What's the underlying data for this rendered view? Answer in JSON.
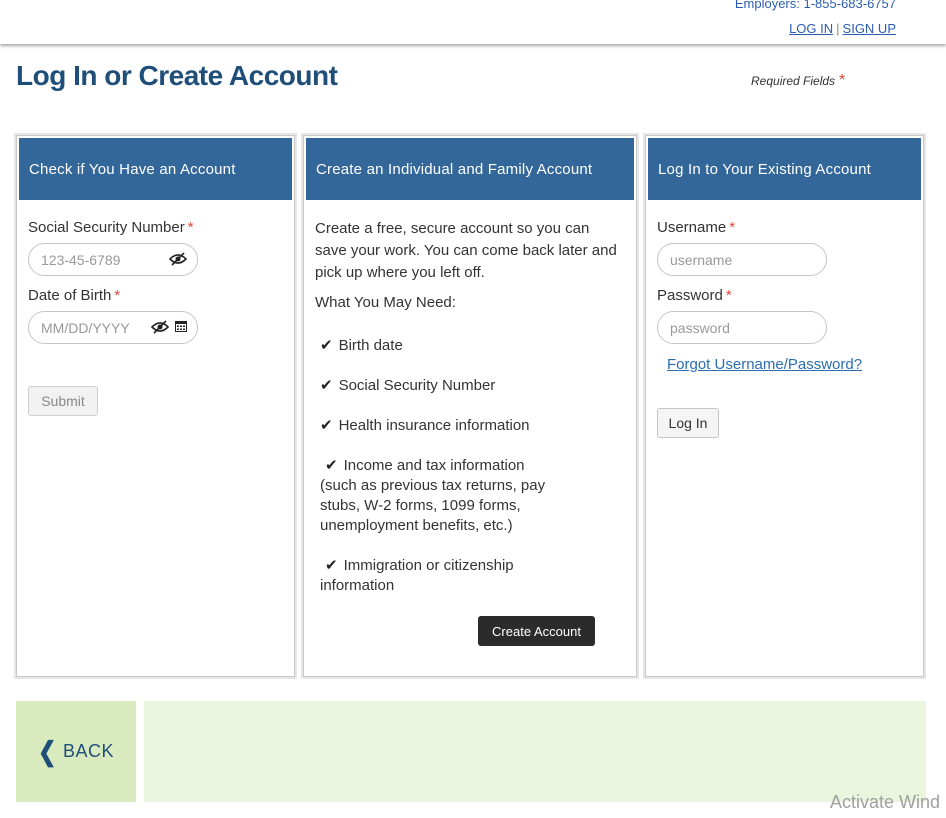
{
  "topbar": {
    "employers": "Employers: 1-855-683-6757",
    "login_link": "LOG IN",
    "separator": "|",
    "signup_link": "SIGN UP"
  },
  "page": {
    "title": "Log In or Create Account",
    "required_label": "Required Fields",
    "required_star": "*"
  },
  "check_panel": {
    "header": "Check if You Have an Account",
    "ssn_label": "Social Security Number",
    "ssn_placeholder": "123-45-6789",
    "dob_label": "Date of Birth",
    "dob_placeholder": "MM/DD/YYYY",
    "required_mark": "*",
    "submit_label": "Submit"
  },
  "create_panel": {
    "header": "Create an Individual and Family Account",
    "intro": "Create a free, secure account so you can save your work. You can come back later and pick up where you left off.",
    "need_title": "What You May Need:",
    "items": [
      "Birth date",
      "Social Security Number",
      "Health insurance information",
      "Income and tax information",
      "Immigration or citizenship"
    ],
    "income_detail": "(such as previous tax returns, pay stubs, W-2 forms, 1099 forms, unemployment benefits, etc.)",
    "immigration_detail": "information",
    "check_icon": "check-icon",
    "create_button": "Create Account"
  },
  "login_panel": {
    "header": "Log In to Your Existing Account",
    "username_label": "Username",
    "username_placeholder": "username",
    "password_label": "Password",
    "password_placeholder": "password",
    "required_mark": "*",
    "forgot_link": "Forgot Username/Password?",
    "login_button": "Log In"
  },
  "footer": {
    "back_label": "BACK"
  },
  "watermark": "Activate Wind",
  "colors": {
    "header_blue": "#336699",
    "title_blue": "#1f4e79",
    "required_red": "#e0483a",
    "back_green": "#d9ebbe",
    "band_green": "#e9f5dd"
  }
}
